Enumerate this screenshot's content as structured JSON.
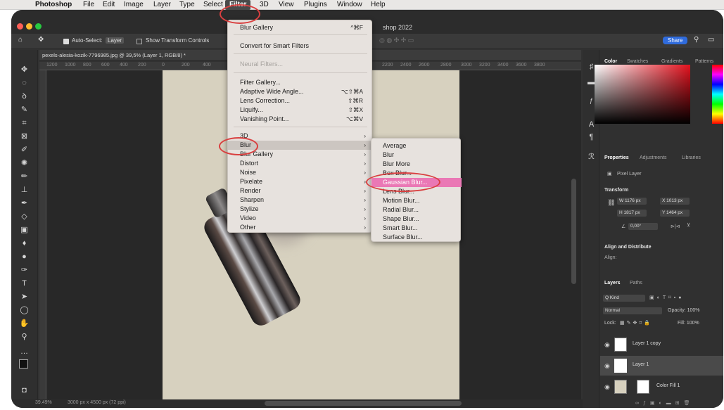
{
  "menubar": {
    "items": [
      "Photoshop",
      "File",
      "Edit",
      "Image",
      "Layer",
      "Type",
      "Select",
      "Filter",
      "3D",
      "View",
      "Plugins",
      "Window",
      "Help"
    ]
  },
  "title": {
    "fragment": "shop 2022"
  },
  "options": {
    "auto_select": "Auto-Select:",
    "layer_dropdown": "Layer",
    "show_transform": "Show Transform Controls",
    "share": "Share"
  },
  "document": {
    "tab_title": "pexels-alesia-kozik-7796985.jpg @ 39,5% (Layer 1, RGB/8) *"
  },
  "ruler": {
    "ticks": [
      "1200",
      "1000",
      "800",
      "600",
      "400",
      "200",
      "0",
      "200",
      "400",
      "2200",
      "2400",
      "2600",
      "2800",
      "3000",
      "3200",
      "3400",
      "3600",
      "3800"
    ]
  },
  "status": {
    "zoom": "39.49%",
    "doc_size": "3000 px x 4500 px (72 ppi)"
  },
  "filter_menu": {
    "blur_gallery": "Blur Gallery",
    "blur_gallery_sc": "^⌘F",
    "convert": "Convert for Smart Filters",
    "neural": "Neural Filters...",
    "gallery": "Filter Gallery...",
    "adaptive": "Adaptive Wide Angle...",
    "adaptive_sc": "⌥⇧⌘A",
    "lens": "Lens Correction...",
    "lens_sc": "⇧⌘R",
    "liquify": "Liquify...",
    "liquify_sc": "⇧⌘X",
    "vanishing": "Vanishing Point...",
    "vanishing_sc": "⌥⌘V",
    "groups": [
      "3D",
      "Blur",
      "Blur Gallery",
      "Distort",
      "Noise",
      "Pixelate",
      "Render",
      "Sharpen",
      "Stylize",
      "Video",
      "Other"
    ]
  },
  "blur_submenu": {
    "items": [
      "Average",
      "Blur",
      "Blur More",
      "Box Blur...",
      "Gaussian Blur...",
      "Lens Blur...",
      "Motion Blur...",
      "Radial Blur...",
      "Shape Blur...",
      "Smart Blur...",
      "Surface Blur..."
    ],
    "selected": "Gaussian Blur..."
  },
  "color_panel": {
    "tabs": [
      "Color",
      "Swatches",
      "Gradients",
      "Patterns"
    ]
  },
  "properties": {
    "tabs": [
      "Properties",
      "Adjustments",
      "Libraries"
    ],
    "kind": "Pixel Layer",
    "transform": "Transform",
    "w": "W  1176 px",
    "x": "X  1013 px",
    "h": "H  1817 px",
    "y": "Y  1464 px",
    "angle": "0,00°",
    "align": "Align and Distribute",
    "align_sub": "Align:"
  },
  "layers_panel": {
    "tabs": [
      "Layers",
      "Paths"
    ],
    "kind": "Q Kind",
    "blend": "Normal",
    "opacity": "Opacity:  100%",
    "lock": "Lock:",
    "fill": "Fill:  100%",
    "layers": [
      "Layer 1 copy",
      "Layer 1",
      "Color Fill 1"
    ]
  },
  "colors": {
    "accent_selected": "#ea78b5",
    "share_button": "#2f6bdc",
    "canvas_beige": "#d7d1bf"
  }
}
